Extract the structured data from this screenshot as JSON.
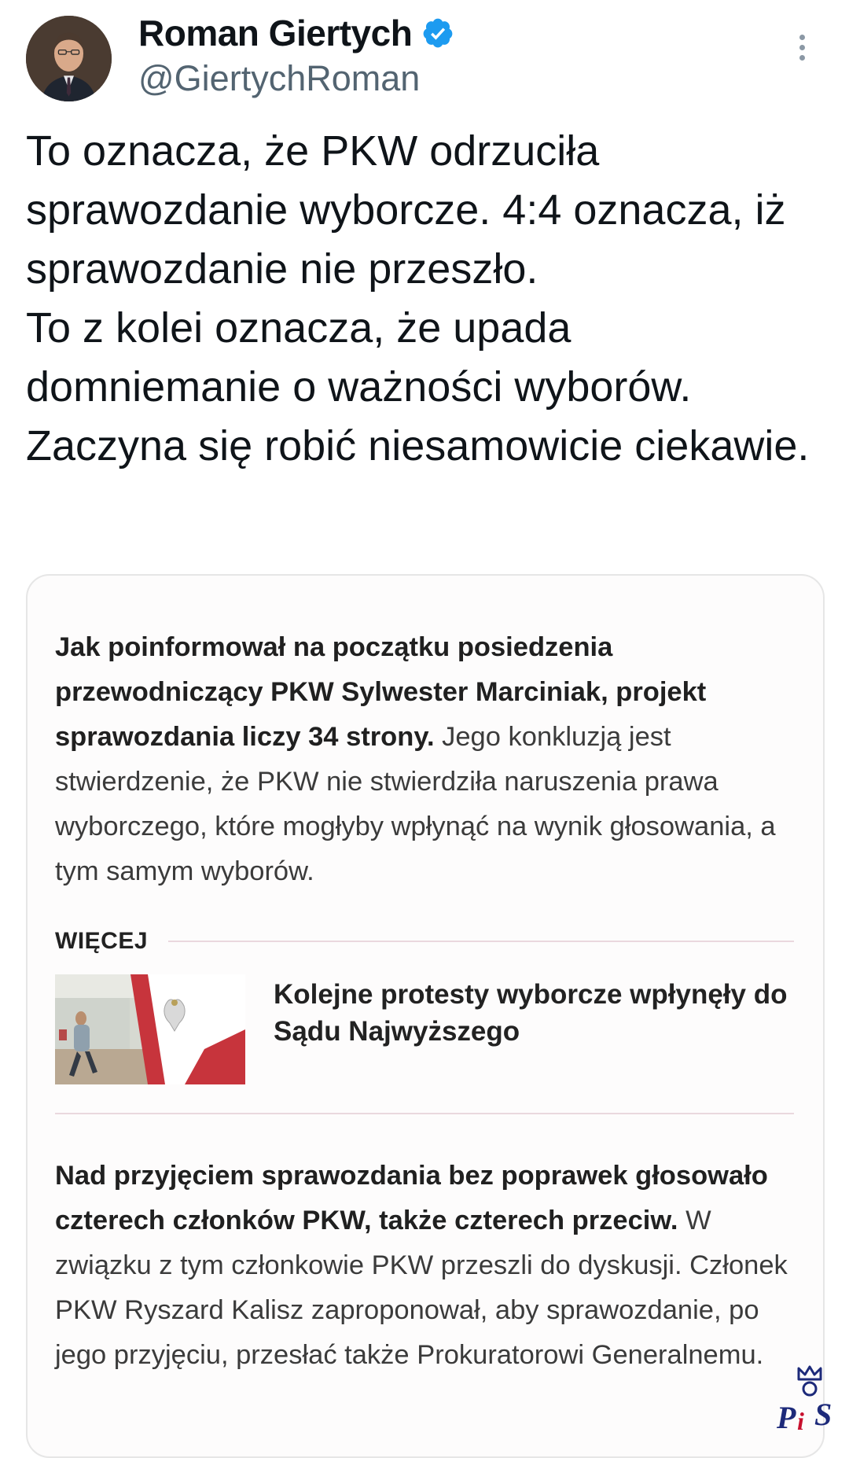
{
  "user": {
    "display_name": "Roman Giertych",
    "handle": "@GiertychRoman",
    "verified": true,
    "verified_color": "#1d9bf0"
  },
  "tweet": {
    "text": "To oznacza, że PKW odrzuciła sprawozdanie wyborcze. 4:4 oznacza, iż sprawozdanie nie przeszło.\nTo z kolei oznacza, że upada domniemanie o ważności wyborów. Zaczyna się robić niesamowicie ciekawie."
  },
  "card": {
    "paragraph1_bold": "Jak poinformował na początku posiedzenia przewodniczący PKW Sylwester Marciniak, projekt sprawozdania liczy 34 strony.",
    "paragraph1_rest": " Jego konkluzją jest stwierdzenie, że PKW nie stwierdziła naruszenia prawa wyborczego, które mogłyby wpłynąć na wynik głosowania, a tym samym wyborów.",
    "more_label": "WIĘCEJ",
    "related_title": "Kolejne protesty wyborcze wpłynęły do Sądu Najwyższego",
    "paragraph2_bold": "Nad przyjęciem sprawozdania bez poprawek głosowało czterech członków PKW, także czterech przeciw.",
    "paragraph2_rest": " W związku z tym członkowie PKW przeszli do dyskusji. Członek PKW Ryszard Kalisz zaproponował, aby sprawozdanie, po jego przyjęciu, przesłać także Prokuratorowi Generalnemu."
  },
  "watermark": {
    "text": "PiS"
  },
  "icons": {
    "verified": "verified-badge-icon",
    "more": "more-vertical-icon"
  }
}
